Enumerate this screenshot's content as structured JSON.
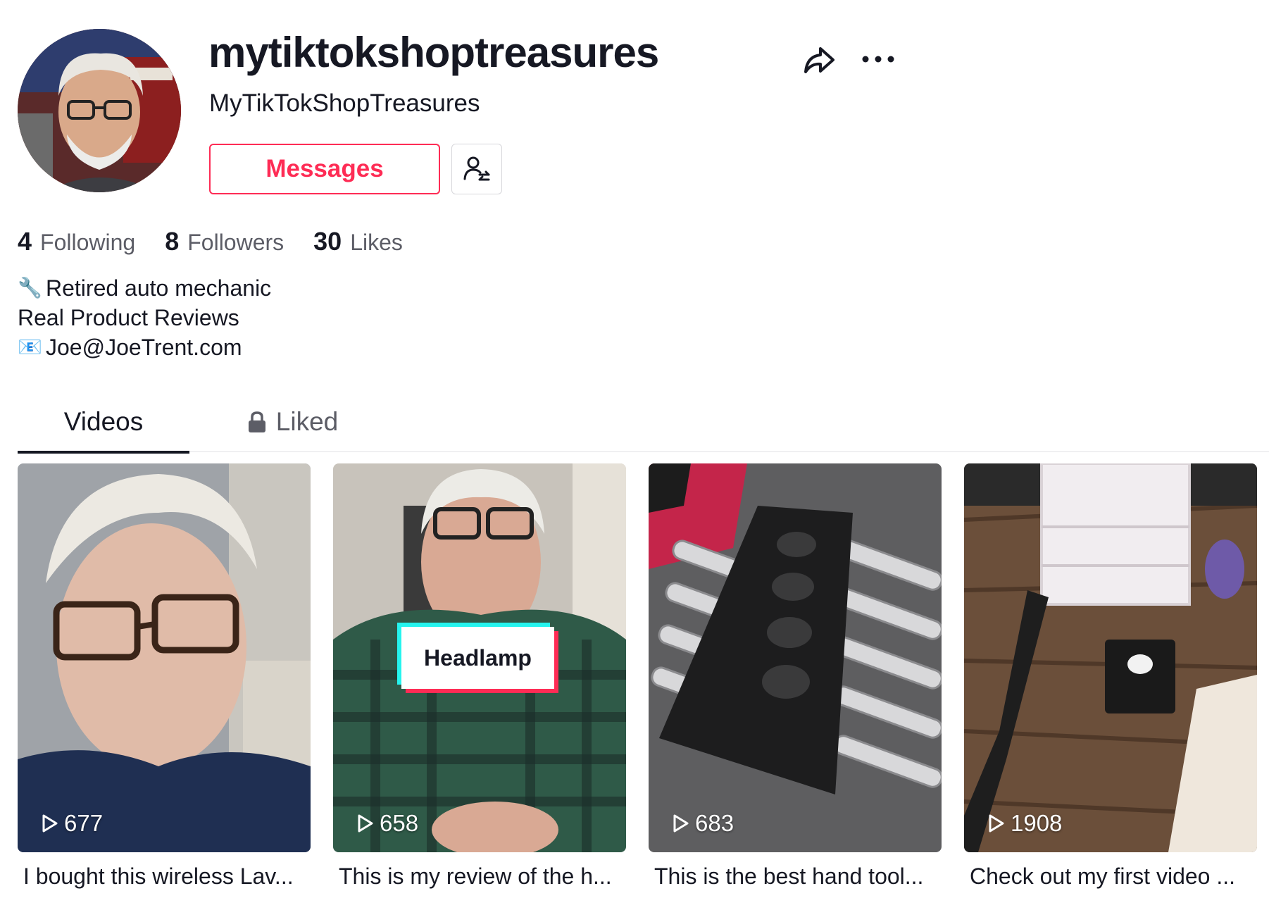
{
  "profile": {
    "username": "mytiktokshoptreasures",
    "nickname": "MyTikTokShopTreasures",
    "messages_label": "Messages"
  },
  "icons": {
    "share": "share-icon",
    "more": "more-icon",
    "follow_switch": "user-switch-icon",
    "lock": "lock-icon",
    "play": "play-icon"
  },
  "stats": [
    {
      "value": "4",
      "label": "Following"
    },
    {
      "value": "8",
      "label": "Followers"
    },
    {
      "value": "30",
      "label": "Likes"
    }
  ],
  "bio": {
    "line1_emoji": "🔧",
    "line1_text": "Retired auto mechanic",
    "line2_text": "Real Product Reviews",
    "line3_emoji": "📧",
    "line3_text": "Joe@JoeTrent.com"
  },
  "tabs": {
    "videos": "Videos",
    "liked": "Liked"
  },
  "videos": [
    {
      "views": "677",
      "caption": "I bought this wireless Lav..."
    },
    {
      "views": "658",
      "caption": "This is my review of the h...",
      "overlay_text": "Headlamp"
    },
    {
      "views": "683",
      "caption": "This is the best hand tool..."
    },
    {
      "views": "1908",
      "caption": "Check out my first video ..."
    }
  ],
  "colors": {
    "accent": "#fe2c55",
    "text": "#161823",
    "secondary_text": "#5c5d66"
  }
}
